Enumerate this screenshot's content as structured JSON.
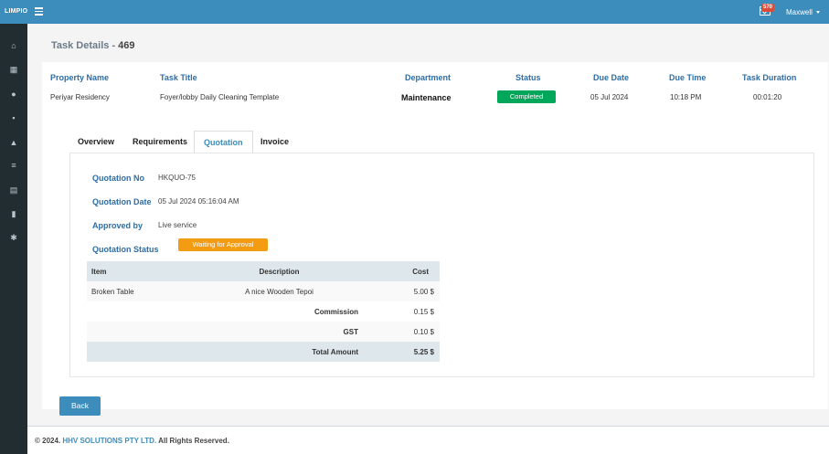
{
  "app": {
    "brand": "LIMPIO",
    "user": "Maxwell",
    "mail_count": "570"
  },
  "sidebar": {
    "icons": [
      "home-icon",
      "calendar-icon",
      "user-icon",
      "grid-icon",
      "flask-icon",
      "list-icon",
      "map-icon",
      "document-icon",
      "gear-icon"
    ]
  },
  "page": {
    "title": "Task Details - ",
    "task_number": "469"
  },
  "task": {
    "headers": {
      "property_name": "Property Name",
      "task_title": "Task Title",
      "department": "Department",
      "status": "Status",
      "due_date": "Due Date",
      "due_time": "Due Time",
      "task_duration": "Task Duration"
    },
    "values": {
      "property_name": "Periyar Residency",
      "task_title": "Foyer/lobby Daily Cleaning Template",
      "department": "Maintenance",
      "status": "Completed",
      "due_date": "05 Jul 2024",
      "due_time": "10:18 PM",
      "task_duration": "00:01:20"
    }
  },
  "tabs": [
    "Overview",
    "Requirements",
    "Quotation",
    "Invoice"
  ],
  "quotation": {
    "labels": {
      "no": "Quotation No",
      "date": "Quotation Date",
      "approved_by": "Approved by",
      "status": "Quotation Status"
    },
    "values": {
      "no": "HKQUO-75",
      "date": "05 Jul 2024 05:16:04 AM",
      "approved_by": "Live service",
      "status": "Waiting for Approval"
    },
    "table": {
      "headers": {
        "item": "Item",
        "description": "Description",
        "cost": "Cost"
      },
      "rows": [
        {
          "item": "Broken Table",
          "description": "A nice Wooden Tepoi",
          "cost": "5.00 $"
        }
      ],
      "commission": {
        "label": "Commission",
        "value": "0.15 $"
      },
      "gst": {
        "label": "GST",
        "value": "0.10 $"
      },
      "total": {
        "label": "Total Amount",
        "value": "5.25 $"
      }
    }
  },
  "buttons": {
    "back": "Back"
  },
  "footer": {
    "prefix": "© 2024. ",
    "company": "HHV SOLUTIONS PTY LTD.",
    "suffix": " All Rights Reserved."
  },
  "colors": {
    "topbar": "#3c8dbc",
    "sidebar": "#222d32",
    "completed": "#00a65a",
    "waiting": "#f39c12"
  }
}
